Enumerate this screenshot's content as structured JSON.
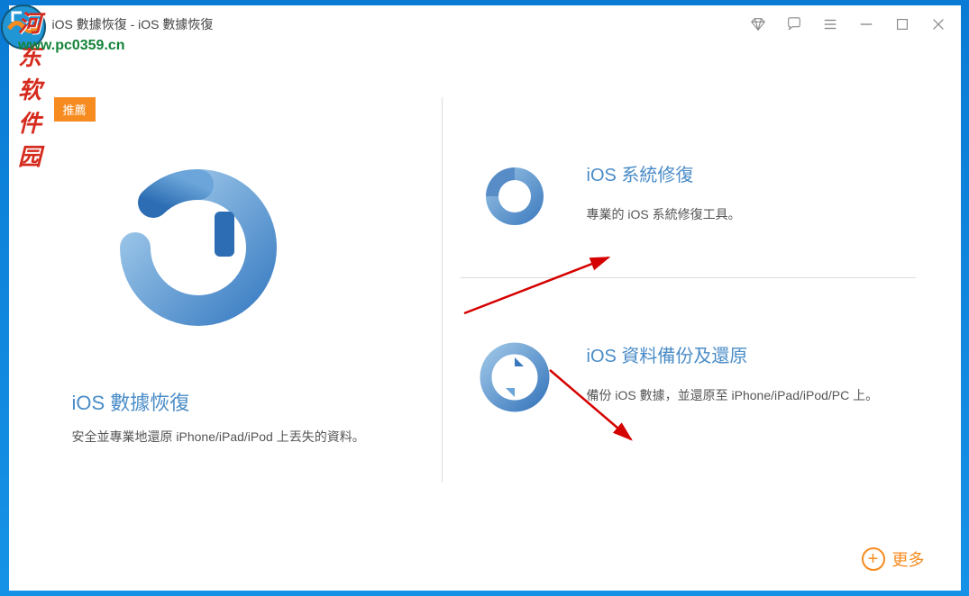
{
  "watermark": {
    "line1": "河东软件园",
    "line2": "www.pc0359.cn"
  },
  "titlebar": {
    "title": "iOS 數據恢復 - iOS 數據恢復"
  },
  "left": {
    "badge": "推薦",
    "title": "iOS 數據恢復",
    "desc": "安全並專業地還原 iPhone/iPad/iPod 上丟失的資料。"
  },
  "right": {
    "items": [
      {
        "title": "iOS 系統修復",
        "desc": "專業的 iOS 系統修復工具。"
      },
      {
        "title": "iOS 資料備份及還原",
        "desc": "備份 iOS 數據，並還原至 iPhone/iPad/iPod/PC 上。"
      }
    ]
  },
  "more": {
    "label": "更多"
  }
}
